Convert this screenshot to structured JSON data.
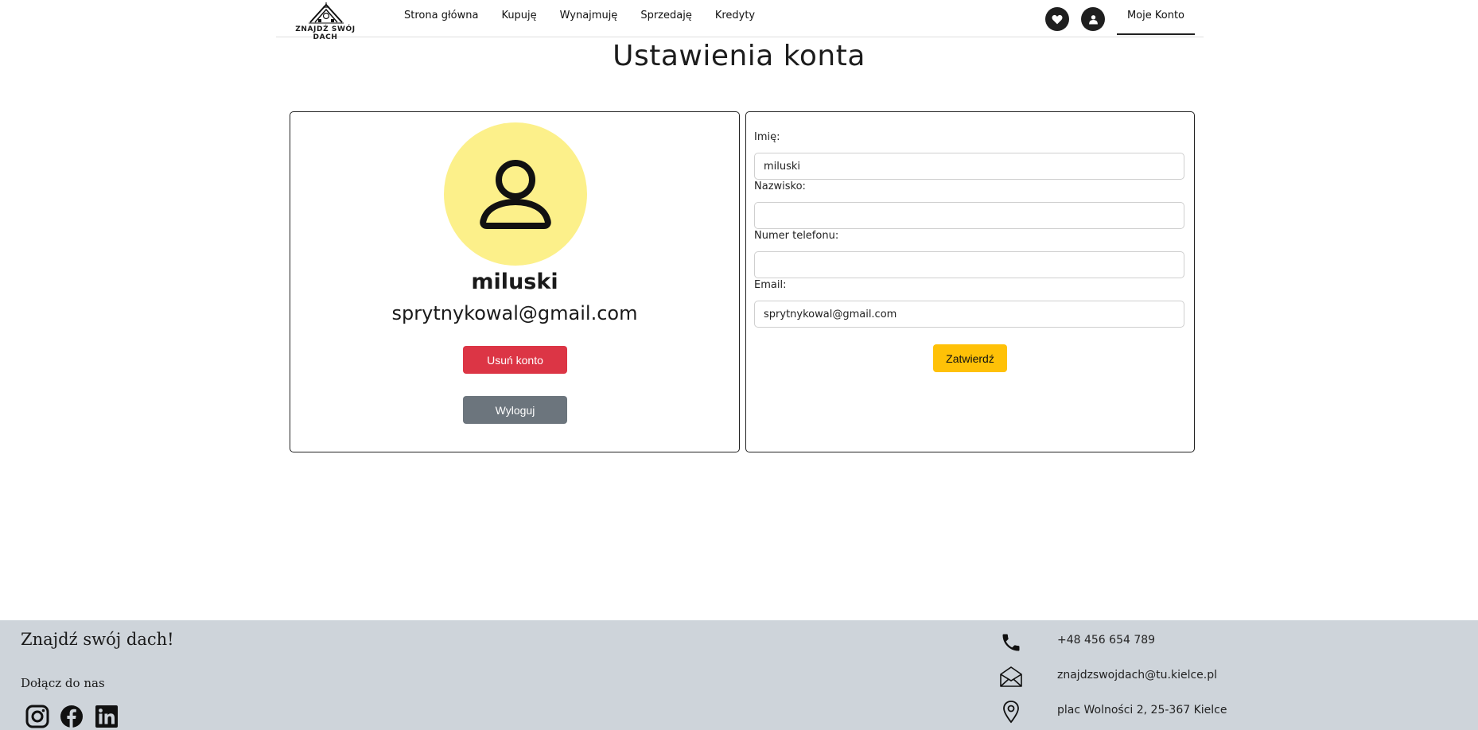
{
  "logo": {
    "text": "ZNAJDŹ SWÓJ DACH",
    "icon": "house-roof-logo"
  },
  "nav": {
    "links": [
      "Strona główna",
      "Kupuję",
      "Wynajmuję",
      "Sprzedaję",
      "Kredyty"
    ],
    "favorites_icon": "heart-icon",
    "user_icon": "user-icon",
    "account_label": "Moje Konto"
  },
  "page": {
    "title": "Ustawienia konta"
  },
  "profile": {
    "name": "miluski",
    "email": "sprytnykowal@gmail.com",
    "avatar_color": "#fcf08a",
    "delete_label": "Usuń konto",
    "logout_label": "Wyloguj"
  },
  "form": {
    "first_name_label": "Imię:",
    "first_name_value": "miluski",
    "last_name_label": "Nazwisko:",
    "last_name_value": "",
    "phone_label": "Numer telefonu:",
    "phone_value": "",
    "email_label": "Email:",
    "email_value": "sprytnykowal@gmail.com",
    "submit_label": "Zatwierdź"
  },
  "colors": {
    "danger": "#dc3545",
    "secondary": "#6c757d",
    "warning": "#ffc107",
    "footer_bg": "#ced4da"
  },
  "footer": {
    "title": "Znajdź swój dach!",
    "join_label": "Dołącz do nas",
    "socials": [
      "instagram-icon",
      "facebook-icon",
      "linkedin-icon"
    ],
    "phone": "+48 456 654 789",
    "email": "znajdzswojdach@tu.kielce.pl",
    "address": "plac Wolności 2, 25-367 Kielce"
  }
}
